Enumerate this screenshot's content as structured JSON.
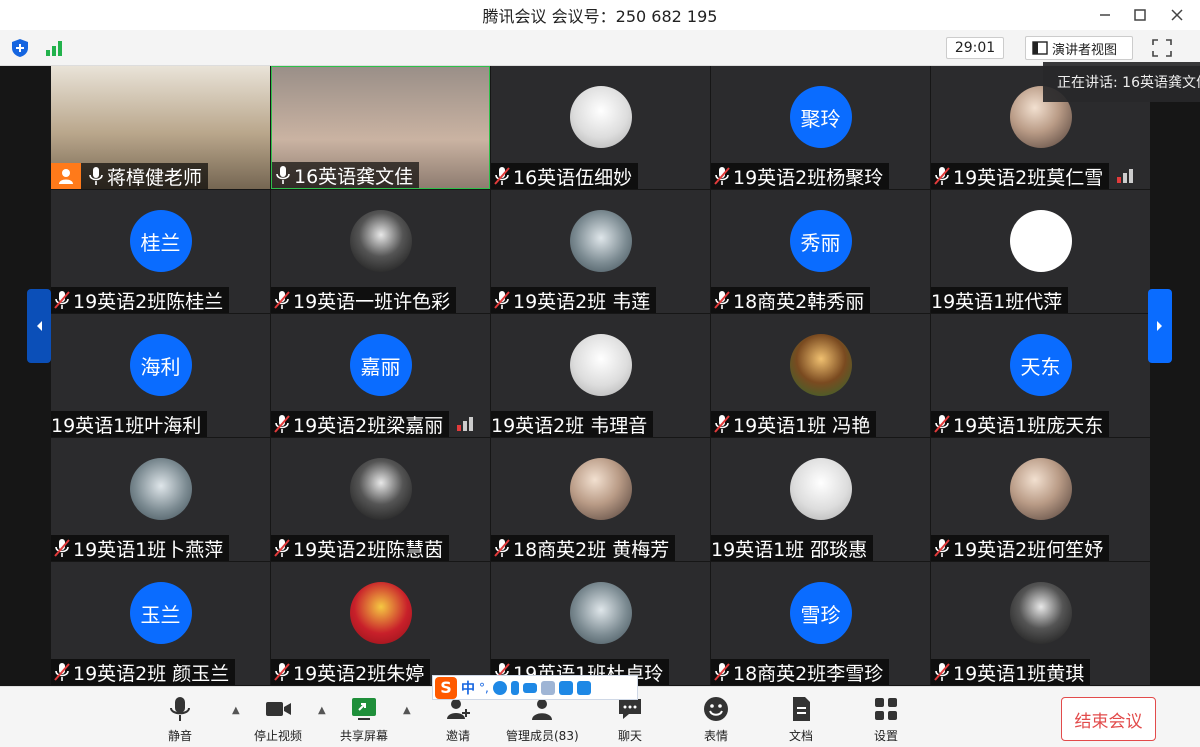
{
  "window": {
    "title": "腾讯会议 会议号：250 682 195",
    "controls": [
      "minimize-icon",
      "maximize-icon",
      "close-icon"
    ]
  },
  "topbar": {
    "timer": "29:01",
    "speaker_view_label": "演讲者视图",
    "icons": [
      "shield-icon",
      "network-signal-icon",
      "fullscreen-icon"
    ]
  },
  "speaking_tooltip": "正在讲话: 16英语龚文佳",
  "participants": [
    {
      "name": "蒋樟健老师",
      "kind": "video",
      "mic": "on",
      "host": true
    },
    {
      "name": "16英语龚文佳",
      "kind": "video",
      "mic": "on"
    },
    {
      "name": "16英语伍细妙",
      "kind": "pic",
      "mic": "muted"
    },
    {
      "name": "19英语2班杨聚玲",
      "kind": "initials",
      "initials": "聚玲",
      "mic": "muted"
    },
    {
      "name": "19英语2班莫仁雪",
      "kind": "pic",
      "mic": "muted",
      "signal": true
    },
    {
      "name": "19英语2班陈桂兰",
      "kind": "initials",
      "initials": "桂兰",
      "mic": "muted"
    },
    {
      "name": "19英语一班许色彩",
      "kind": "pic",
      "mic": "muted"
    },
    {
      "name": "19英语2班 韦莲",
      "kind": "pic",
      "mic": "muted"
    },
    {
      "name": "18商英2韩秀丽",
      "kind": "initials",
      "initials": "秀丽",
      "mic": "muted"
    },
    {
      "name": "19英语1班代萍",
      "kind": "pic",
      "mic": "none"
    },
    {
      "name": "19英语1班叶海利",
      "kind": "initials",
      "initials": "海利",
      "mic": "none"
    },
    {
      "name": "19英语2班梁嘉丽",
      "kind": "initials",
      "initials": "嘉丽",
      "mic": "muted",
      "signal": true
    },
    {
      "name": "19英语2班 韦理音",
      "kind": "pic",
      "mic": "none"
    },
    {
      "name": "19英语1班 冯艳",
      "kind": "pic",
      "mic": "muted"
    },
    {
      "name": "19英语1班庞天东",
      "kind": "initials",
      "initials": "天东",
      "mic": "muted"
    },
    {
      "name": "19英语1班卜燕萍",
      "kind": "pic",
      "mic": "muted"
    },
    {
      "name": "19英语2班陈慧茵",
      "kind": "pic",
      "mic": "muted"
    },
    {
      "name": "18商英2班 黄梅芳",
      "kind": "pic",
      "mic": "muted"
    },
    {
      "name": "19英语1班 邵琰惠",
      "kind": "pic",
      "mic": "none"
    },
    {
      "name": "19英语2班何笙妤",
      "kind": "pic",
      "mic": "muted"
    },
    {
      "name": "19英语2班 颜玉兰",
      "kind": "initials",
      "initials": "玉兰",
      "mic": "muted"
    },
    {
      "name": "19英语2班朱婷",
      "kind": "pic",
      "mic": "muted"
    },
    {
      "name": "19英语1班杜卓玲",
      "kind": "pic",
      "mic": "muted"
    },
    {
      "name": "18商英2班李雪珍",
      "kind": "initials",
      "initials": "雪珍",
      "mic": "muted"
    },
    {
      "name": "19英语1班黄琪",
      "kind": "pic",
      "mic": "muted"
    }
  ],
  "toolbar": {
    "mute": "静音",
    "stop_video": "停止视频",
    "share_screen": "共享屏幕",
    "invite": "邀请",
    "manage_members": "管理成员(83)",
    "chat": "聊天",
    "emoji": "表情",
    "docs": "文档",
    "settings": "设置",
    "end_meeting": "结束会议"
  },
  "ime": {
    "logo": "S",
    "mode": "中",
    "punct": "°,"
  },
  "colors": {
    "accent": "#0a6cff",
    "host_badge": "#ff7a1a",
    "muted_red": "#e23b3b",
    "end_red": "#e24b4b",
    "active_speaker_border": "#2fbf4a"
  }
}
